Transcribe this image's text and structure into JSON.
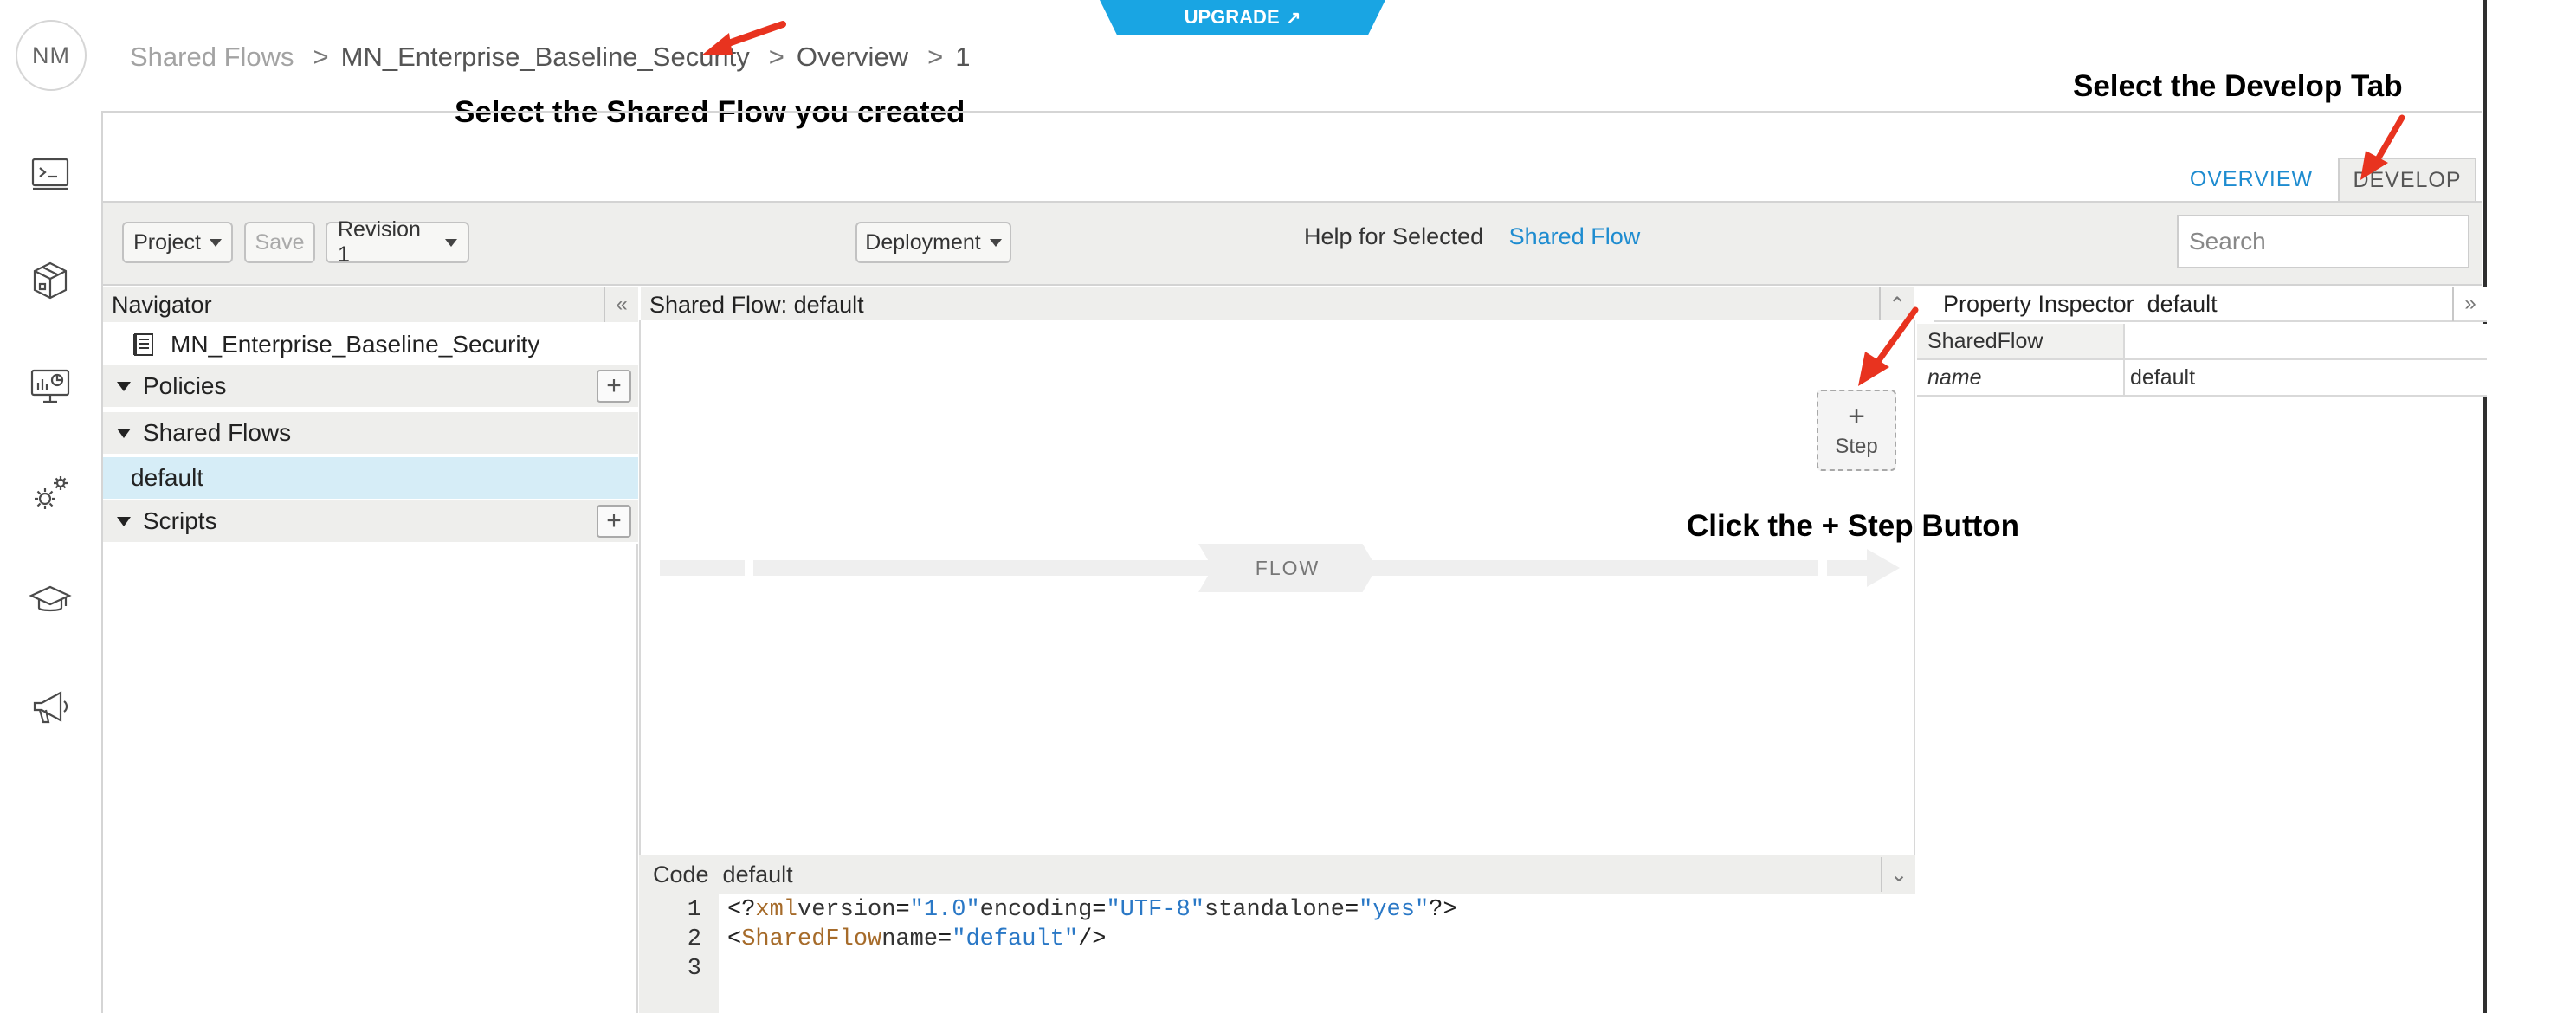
{
  "user": {
    "initials": "NM"
  },
  "upgrade": {
    "label": "UPGRADE",
    "icon": "external-arrow-icon"
  },
  "breadcrumb": {
    "items": [
      "Shared Flows",
      "MN_Enterprise_Baseline_Security",
      "Overview",
      "1"
    ],
    "separator": ">"
  },
  "annotations": {
    "select_shared_flow": "Select the Shared Flow you created",
    "select_develop_tab": "Select the Develop Tab",
    "click_step": "Click the + Step Button"
  },
  "tabs": {
    "overview": "OVERVIEW",
    "develop": "DEVELOP",
    "active": "develop"
  },
  "toolbar": {
    "project_label": "Project",
    "save_label": "Save",
    "revision_label": "Revision 1",
    "deployment_label": "Deployment",
    "help_prefix": "Help for Selected",
    "help_link": "Shared Flow",
    "search_placeholder": "Search"
  },
  "navigator": {
    "title": "Navigator",
    "collapse_glyph": "«",
    "root_item": "MN_Enterprise_Baseline_Security",
    "sections": {
      "policies": "Policies",
      "shared_flows": "Shared Flows",
      "scripts": "Scripts"
    },
    "shared_flow_items": [
      "default"
    ],
    "add_glyph": "+"
  },
  "flow_panel": {
    "title": "Shared Flow: default",
    "step_plus": "+",
    "step_label": "Step",
    "flow_label": "FLOW",
    "collapse_glyph": "⌃"
  },
  "property_inspector": {
    "title": "Property Inspector  default",
    "collapse_glyph": "»",
    "rows": [
      {
        "key": "SharedFlow",
        "value": ""
      },
      {
        "key": "name",
        "value": "default"
      }
    ]
  },
  "code_panel": {
    "label": "Code",
    "file": "default",
    "line_numbers": [
      "1",
      "2",
      "3"
    ],
    "lines": [
      "<?xml version=\"1.0\" encoding=\"UTF-8\" standalone=\"yes\"?>",
      "<SharedFlow name=\"default\"/>",
      ""
    ]
  },
  "colors": {
    "accent": "#1e8cd0",
    "upgrade": "#19a5e3",
    "arrow": "#e8331f",
    "panel_bg": "#eeeeec",
    "selected_row": "#d6edf7"
  }
}
